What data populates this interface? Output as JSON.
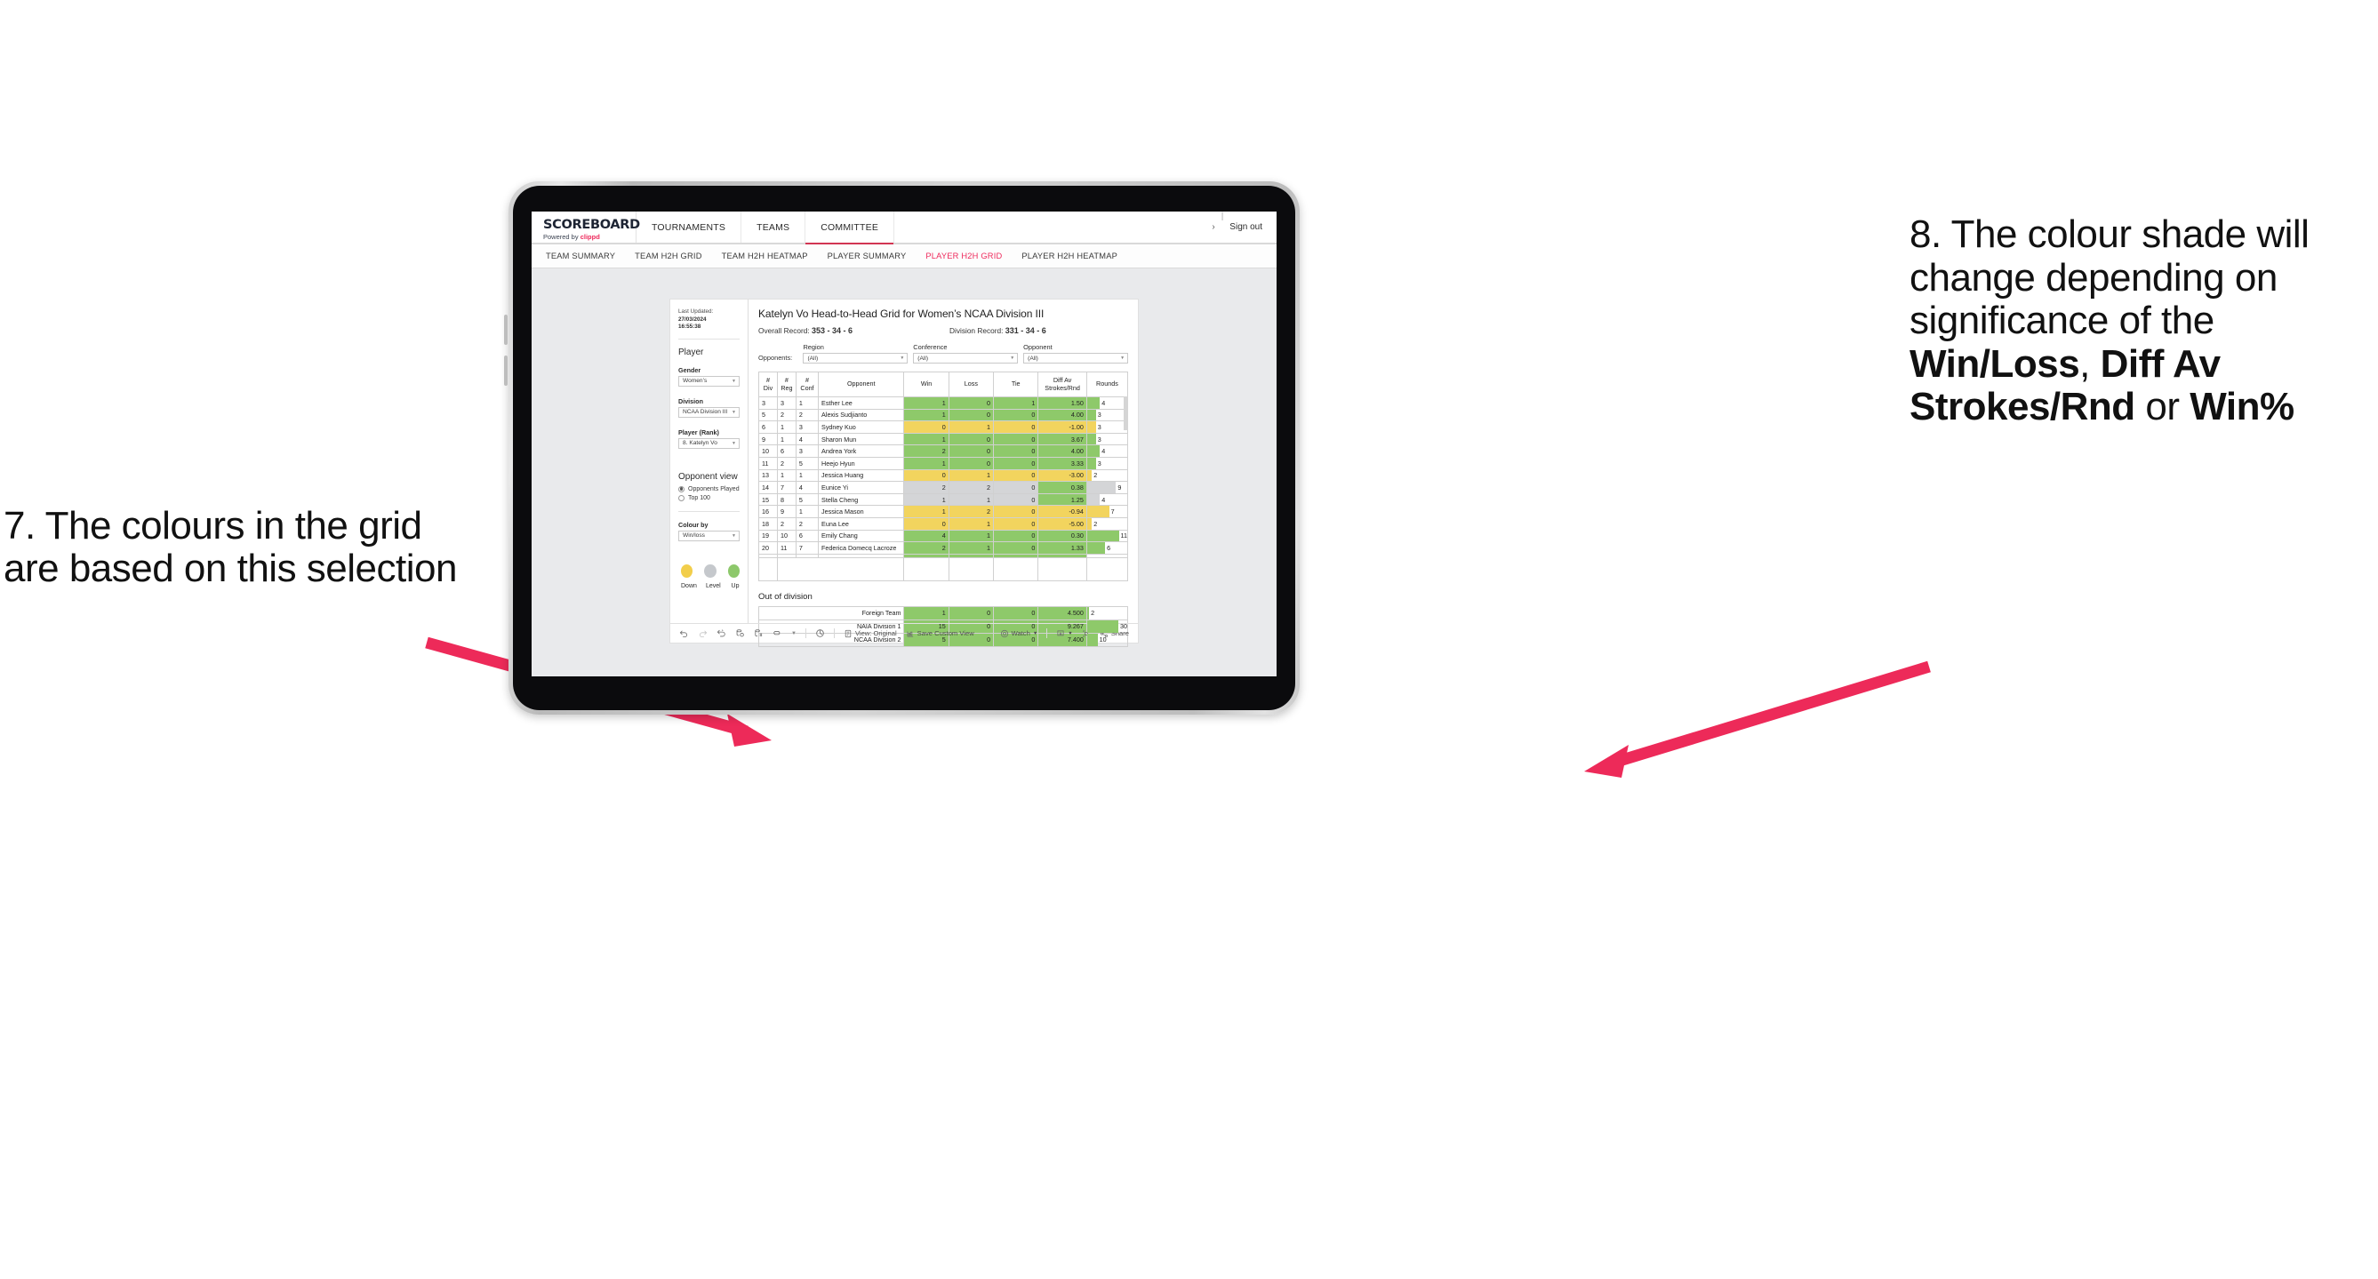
{
  "annotations": {
    "left": "7. The colours in the grid are based on this selection",
    "right_parts": [
      {
        "text": "8. The colour shade will change depending on significance of the ",
        "bold": false
      },
      {
        "text": "Win/Loss",
        "bold": true
      },
      {
        "text": ", ",
        "bold": false
      },
      {
        "text": "Diff Av Strokes/Rnd",
        "bold": true
      },
      {
        "text": " or ",
        "bold": false
      },
      {
        "text": "Win%",
        "bold": true
      }
    ],
    "arrow_color": "#ED2A59"
  },
  "app": {
    "logo": {
      "main": "SCOREBOARD",
      "powered": "Powered by",
      "brand": "clippd"
    },
    "nav": [
      {
        "label": "TOURNAMENTS",
        "active": false
      },
      {
        "label": "TEAMS",
        "active": false
      },
      {
        "label": "COMMITTEE",
        "active": true
      }
    ],
    "account": {
      "chevron": "›",
      "divider": "|",
      "signout": "Sign out"
    },
    "subnav": [
      {
        "label": "TEAM SUMMARY",
        "active": false
      },
      {
        "label": "TEAM H2H GRID",
        "active": false
      },
      {
        "label": "TEAM H2H HEATMAP",
        "active": false
      },
      {
        "label": "PLAYER SUMMARY",
        "active": false
      },
      {
        "label": "PLAYER H2H GRID",
        "active": true
      },
      {
        "label": "PLAYER H2H HEATMAP",
        "active": false
      }
    ]
  },
  "sidebar": {
    "last_updated_label": "Last Updated:",
    "last_updated_date": "27/03/2024",
    "last_updated_time": "16:55:38",
    "player_heading": "Player",
    "fields": [
      {
        "label": "Gender",
        "value": "Women’s"
      },
      {
        "label": "Division",
        "value": "NCAA Division III"
      },
      {
        "label": "Player (Rank)",
        "value": "8. Katelyn Vo"
      }
    ],
    "opponent_view_heading": "Opponent view",
    "opponent_view_options": [
      {
        "label": "Opponents Played",
        "selected": true
      },
      {
        "label": "Top 100",
        "selected": false
      }
    ],
    "colour_by_label": "Colour by",
    "colour_by_value": "Win/loss",
    "legend": [
      {
        "label": "Down",
        "color": "#F2CE4B"
      },
      {
        "label": "Level",
        "color": "#C5C8CC"
      },
      {
        "label": "Up",
        "color": "#8DC86B"
      }
    ]
  },
  "viz": {
    "title": "Katelyn Vo Head-to-Head Grid for Women’s NCAA Division III",
    "overall_record_label": "Overall Record:",
    "overall_record_value": "353 -  34 - 6",
    "division_record_label": "Division Record:",
    "division_record_value": "331 -  34 - 6",
    "opponents_label": "Opponents:",
    "filters": [
      {
        "label": "Region",
        "value": "(All)"
      },
      {
        "label": "Conference",
        "value": "(All)"
      },
      {
        "label": "Opponent",
        "value": "(All)"
      }
    ],
    "columns": [
      "# Div",
      "# Reg",
      "# Conf",
      "Opponent",
      "Win",
      "Loss",
      "Tie",
      "Diff Av Strokes/Rnd",
      "Rounds"
    ],
    "columns_split": [
      {
        "l1": "#",
        "l2": "Div"
      },
      {
        "l1": "#",
        "l2": "Reg"
      },
      {
        "l1": "#",
        "l2": "Conf"
      },
      {
        "l1": "Opponent",
        "l2": ""
      },
      {
        "l1": "Win",
        "l2": ""
      },
      {
        "l1": "Loss",
        "l2": ""
      },
      {
        "l1": "Tie",
        "l2": ""
      },
      {
        "l1": "Diff Av",
        "l2": "Strokes/Rnd"
      },
      {
        "l1": "Rounds",
        "l2": ""
      }
    ],
    "rows": [
      {
        "div": "3",
        "reg": "3",
        "conf": "1",
        "opponent": "Esther Lee",
        "win": "1",
        "loss": "0",
        "tie": "1",
        "diff": "1.50",
        "rounds": "4",
        "shade": "g",
        "bar_pct": 32
      },
      {
        "div": "5",
        "reg": "2",
        "conf": "2",
        "opponent": "Alexis Sudjianto",
        "win": "1",
        "loss": "0",
        "tie": "0",
        "diff": "4.00",
        "rounds": "3",
        "shade": "g",
        "bar_pct": 22
      },
      {
        "div": "6",
        "reg": "1",
        "conf": "3",
        "opponent": "Sydney Kuo",
        "win": "0",
        "loss": "1",
        "tie": "0",
        "diff": "-1.00",
        "rounds": "3",
        "shade": "y",
        "bar_pct": 22
      },
      {
        "div": "9",
        "reg": "1",
        "conf": "4",
        "opponent": "Sharon Mun",
        "win": "1",
        "loss": "0",
        "tie": "0",
        "diff": "3.67",
        "rounds": "3",
        "shade": "g",
        "bar_pct": 22
      },
      {
        "div": "10",
        "reg": "6",
        "conf": "3",
        "opponent": "Andrea York",
        "win": "2",
        "loss": "0",
        "tie": "0",
        "diff": "4.00",
        "rounds": "4",
        "shade": "g",
        "bar_pct": 32
      },
      {
        "div": "11",
        "reg": "2",
        "conf": "5",
        "opponent": "Heejo Hyun",
        "win": "1",
        "loss": "0",
        "tie": "0",
        "diff": "3.33",
        "rounds": "3",
        "shade": "g",
        "bar_pct": 22
      },
      {
        "div": "13",
        "reg": "1",
        "conf": "1",
        "opponent": "Jessica Huang",
        "win": "0",
        "loss": "1",
        "tie": "0",
        "diff": "-3.00",
        "rounds": "2",
        "shade": "y",
        "bar_pct": 12
      },
      {
        "div": "14",
        "reg": "7",
        "conf": "4",
        "opponent": "Eunice Yi",
        "win": "2",
        "loss": "2",
        "tie": "0",
        "diff": "0.38",
        "rounds": "9",
        "shade": "n",
        "diff_shade": "g",
        "bar_pct": 72
      },
      {
        "div": "15",
        "reg": "8",
        "conf": "5",
        "opponent": "Stella Cheng",
        "win": "1",
        "loss": "1",
        "tie": "0",
        "diff": "1.25",
        "rounds": "4",
        "shade": "n",
        "diff_shade": "g",
        "bar_pct": 32
      },
      {
        "div": "16",
        "reg": "9",
        "conf": "1",
        "opponent": "Jessica Mason",
        "win": "1",
        "loss": "2",
        "tie": "0",
        "diff": "-0.94",
        "rounds": "7",
        "shade": "y",
        "bar_pct": 55
      },
      {
        "div": "18",
        "reg": "2",
        "conf": "2",
        "opponent": "Euna Lee",
        "win": "0",
        "loss": "1",
        "tie": "0",
        "diff": "-5.00",
        "rounds": "2",
        "shade": "y",
        "bar_pct": 12
      },
      {
        "div": "19",
        "reg": "10",
        "conf": "6",
        "opponent": "Emily Chang",
        "win": "4",
        "loss": "1",
        "tie": "0",
        "diff": "0.30",
        "rounds": "11",
        "shade": "g",
        "bar_pct": 90
      },
      {
        "div": "20",
        "reg": "11",
        "conf": "7",
        "opponent": "Federica Domecq Lacroze",
        "win": "2",
        "loss": "1",
        "tie": "0",
        "diff": "1.33",
        "rounds": "6",
        "shade": "g",
        "bar_pct": 45
      }
    ],
    "out_of_division_title": "Out of division",
    "out_of_division_rows": [
      {
        "name": "Foreign Team",
        "win": "1",
        "loss": "0",
        "tie": "0",
        "diff": "4.500",
        "rounds": "2",
        "shade": "g",
        "bar_pct": 5
      },
      {
        "name": "NAIA Division 1",
        "win": "15",
        "loss": "0",
        "tie": "0",
        "diff": "9.267",
        "rounds": "30",
        "shade": "g",
        "bar_pct": 90
      },
      {
        "name": "NCAA Division 2",
        "win": "5",
        "loss": "0",
        "tie": "0",
        "diff": "7.400",
        "rounds": "10",
        "shade": "g",
        "bar_pct": 26
      }
    ],
    "toolbar": {
      "view_label": "View: Original",
      "save_label": "Save Custom View",
      "watch_label": "Watch",
      "share_label": "Share"
    }
  },
  "colors": {
    "green": "#8EC96A",
    "yellow": "#F2D45E",
    "neutral": "#D4D5D7",
    "accent_pink": "#EE2A5C"
  }
}
